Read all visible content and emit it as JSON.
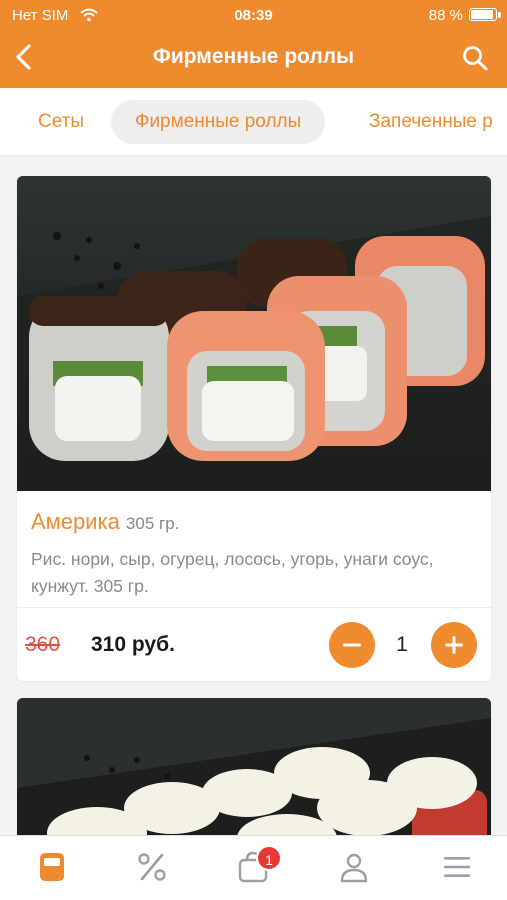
{
  "status_bar": {
    "carrier": "Нет SIM",
    "time": "08:39",
    "battery": "88 %"
  },
  "header": {
    "title": "Фирменные роллы"
  },
  "categories": [
    {
      "label": "Сеты",
      "active": false
    },
    {
      "label": "Фирменные роллы",
      "active": true
    },
    {
      "label": "Запеченные р",
      "active": false
    }
  ],
  "products": [
    {
      "name": "Америка",
      "weight": "305 гр.",
      "description": "Рис. нори, сыр, огурец, лосось, угорь, унаги соус, кунжут. 305 гр.",
      "old_price": "360",
      "price": "310 руб.",
      "quantity": "1"
    }
  ],
  "tabbar": {
    "items": [
      "menu-icon",
      "percent-icon",
      "cart-icon",
      "profile-icon",
      "hamburger-icon"
    ],
    "cart_badge": "1"
  },
  "colors": {
    "accent": "#ef8a2e",
    "old_price": "#e05040",
    "badge": "#e53935"
  }
}
